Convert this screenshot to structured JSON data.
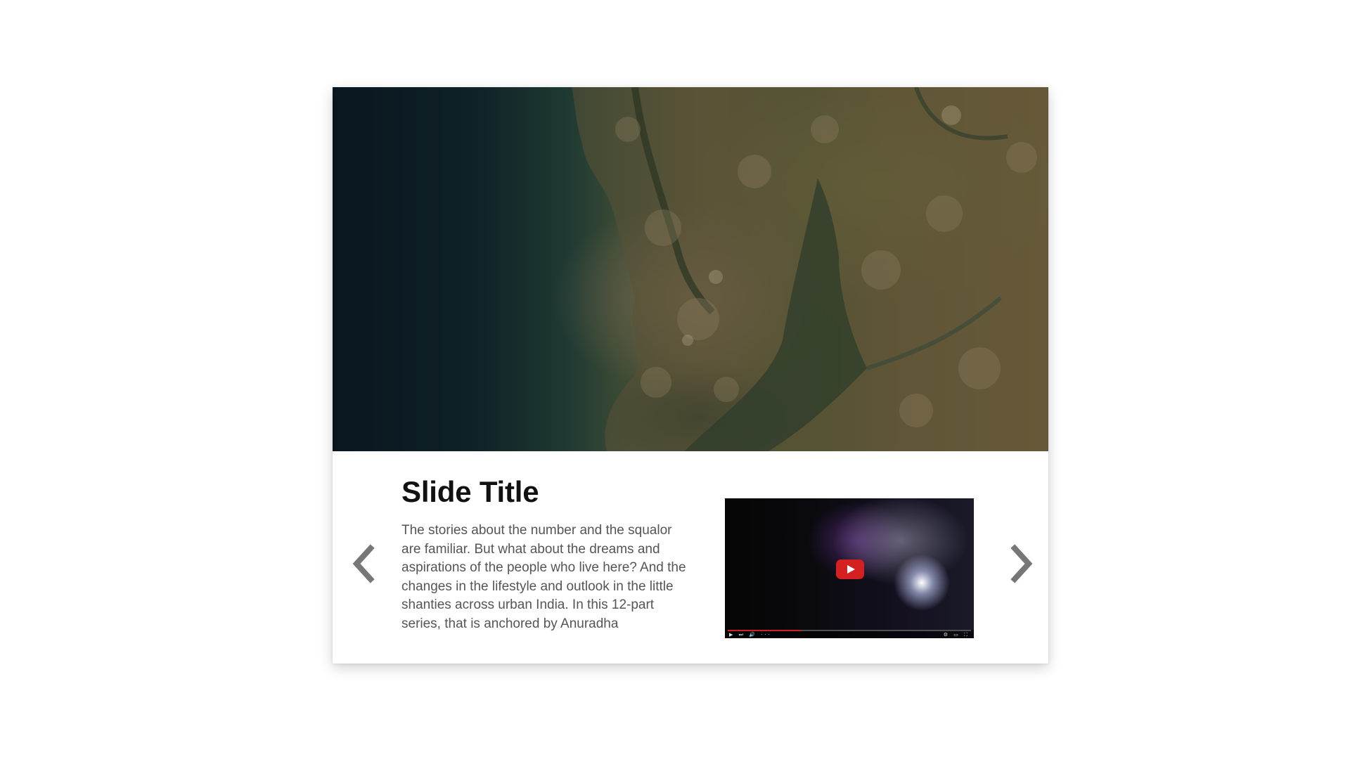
{
  "slide": {
    "title": "Slide Title",
    "description": "The stories about the number and the squalor are familiar. But what about the dreams and aspirations of the people who live here? And the changes in the lifestyle and outlook in the little shanties across urban India. In this 12-part series, that is anchored by Anuradha"
  },
  "hero_image": {
    "icon": "satellite-map-image"
  },
  "video": {
    "icon": "youtube-play-icon",
    "accent_color": "#d42020",
    "progress": 0.3,
    "controls_left": "▶ ⏭ 🔊 ···",
    "controls_right": "⚙ ▭ ⛶"
  },
  "navigation": {
    "prev_icon": "chevron-left-icon",
    "next_icon": "chevron-right-icon",
    "arrow_color": "#777777"
  }
}
